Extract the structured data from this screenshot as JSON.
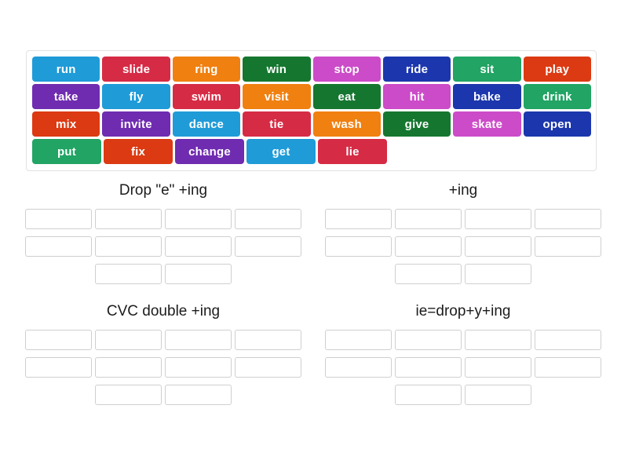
{
  "word_bank": {
    "rows": [
      [
        {
          "label": "run",
          "color": "#1f9bd8"
        },
        {
          "label": "slide",
          "color": "#d62b45"
        },
        {
          "label": "ring",
          "color": "#f08010"
        },
        {
          "label": "win",
          "color": "#15772f"
        },
        {
          "label": "stop",
          "color": "#cc4bc8"
        },
        {
          "label": "ride",
          "color": "#1c37ad"
        },
        {
          "label": "sit",
          "color": "#21a464"
        },
        {
          "label": "play",
          "color": "#dc3a12"
        }
      ],
      [
        {
          "label": "take",
          "color": "#6f2cb0"
        },
        {
          "label": "fly",
          "color": "#1f9bd8"
        },
        {
          "label": "swim",
          "color": "#d62b45"
        },
        {
          "label": "visit",
          "color": "#f08010"
        },
        {
          "label": "eat",
          "color": "#15772f"
        },
        {
          "label": "hit",
          "color": "#cc4bc8"
        },
        {
          "label": "bake",
          "color": "#1c37ad"
        },
        {
          "label": "drink",
          "color": "#21a464"
        }
      ],
      [
        {
          "label": "mix",
          "color": "#dc3a12"
        },
        {
          "label": "invite",
          "color": "#6f2cb0"
        },
        {
          "label": "dance",
          "color": "#1f9bd8"
        },
        {
          "label": "tie",
          "color": "#d62b45"
        },
        {
          "label": "wash",
          "color": "#f08010"
        },
        {
          "label": "give",
          "color": "#15772f"
        },
        {
          "label": "skate",
          "color": "#cc4bc8"
        },
        {
          "label": "open",
          "color": "#1c37ad"
        }
      ],
      [
        {
          "label": "put",
          "color": "#21a464"
        },
        {
          "label": "fix",
          "color": "#dc3a12"
        },
        {
          "label": "change",
          "color": "#6f2cb0"
        },
        {
          "label": "get",
          "color": "#1f9bd8"
        },
        {
          "label": "lie",
          "color": "#d62b45"
        }
      ]
    ]
  },
  "categories": [
    {
      "title": "Drop \"e\" +ing",
      "slot_rows": [
        4,
        4,
        2
      ]
    },
    {
      "title": "+ing",
      "slot_rows": [
        4,
        4,
        2
      ]
    },
    {
      "title": "CVC double +ing",
      "slot_rows": [
        4,
        4,
        2
      ]
    },
    {
      "title": "ie=drop+y+ing",
      "slot_rows": [
        4,
        4,
        2
      ]
    }
  ]
}
